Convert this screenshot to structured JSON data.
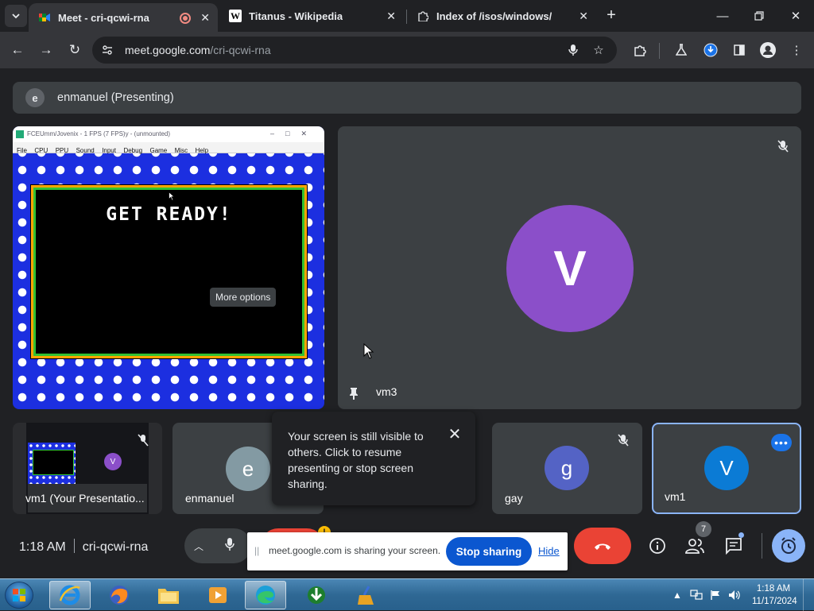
{
  "browser": {
    "tabs": [
      {
        "title": "Meet - cri-qcwi-rna",
        "favicon": "meet-icon",
        "recording": true,
        "active": true
      },
      {
        "title": "Titanus - Wikipedia",
        "favicon": "wikipedia-icon",
        "active": false
      },
      {
        "title": "Index of /isos/windows/",
        "favicon": "puzzle-icon",
        "active": false
      }
    ],
    "url_host": "meet.google.com",
    "url_path": "/cri-qcwi-rna"
  },
  "meet": {
    "presenter_initial": "e",
    "presenting_label": "enmanuel (Presenting)",
    "shared_screen": {
      "window_title": "FCEUmm/Jovenix - 1 FPS (7 FPS)y - (unmounted)",
      "menu": [
        "File",
        "CPU",
        "PPU",
        "Sound",
        "Input",
        "Debug",
        "Game",
        "Misc",
        "Help"
      ],
      "game_text": "GET READY!",
      "tooltip": "More options"
    },
    "main_tile": {
      "initial": "V",
      "name": "vm3",
      "avatar_color": "#8b4fc9"
    },
    "strip": [
      {
        "name": "vm1 (Your Presentatio...",
        "kind": "self-preview",
        "mini_initial": "V"
      },
      {
        "name": "enmanuel",
        "initial": "e",
        "avatar_color": "#839aa3"
      },
      {
        "name": "gay",
        "initial": "g",
        "avatar_color": "#5463c5"
      },
      {
        "name": "vm1",
        "initial": "V",
        "avatar_color": "#0b7bd5"
      }
    ],
    "popup_message": "Your screen is still visible to others. Click to resume presenting or stop screen sharing.",
    "meeting_time": "1:18 AM",
    "meeting_code": "cri-qcwi-rna",
    "people_count": "7",
    "share_banner": {
      "message": "meet.google.com is sharing your screen.",
      "stop_label": "Stop sharing",
      "hide_label": "Hide"
    }
  },
  "taskbar": {
    "apps": [
      "internet-explorer-icon",
      "firefox-icon",
      "file-explorer-icon",
      "media-player-icon",
      "edge-icon",
      "download-manager-icon",
      "ccleaner-icon"
    ],
    "clock_time": "1:18 AM",
    "clock_date": "11/17/2024"
  },
  "colors": {
    "accent_blue": "#8ab4f8",
    "end_call_red": "#ea4335",
    "stop_sharing_blue": "#0b57d0"
  }
}
